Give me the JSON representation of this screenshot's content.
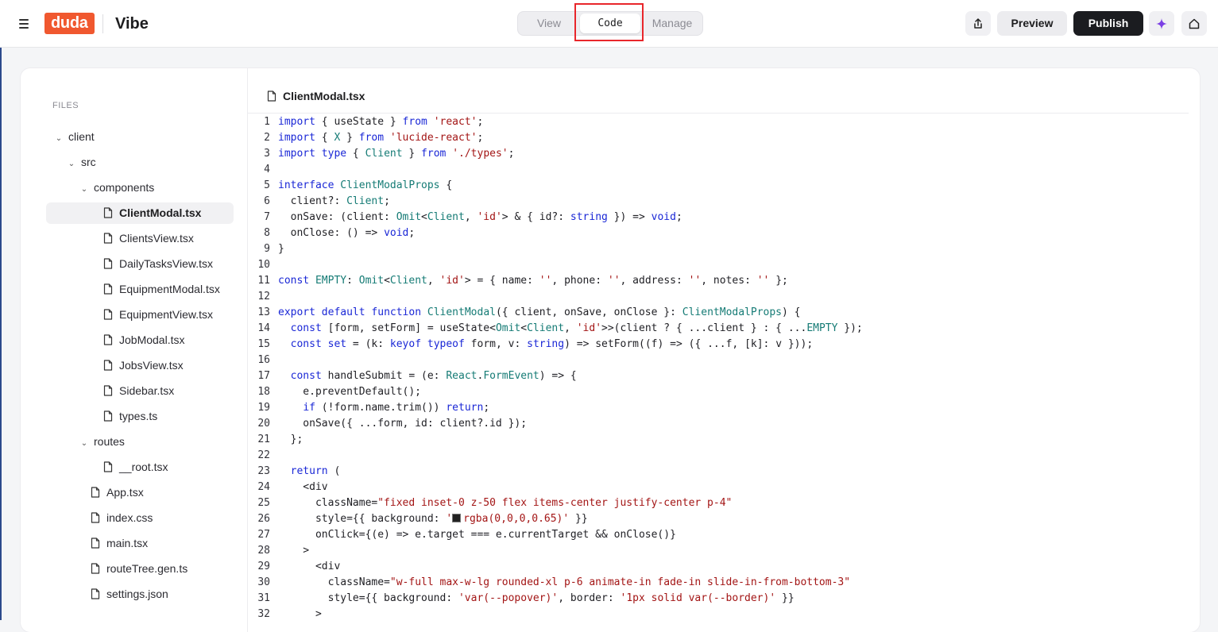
{
  "topbar": {
    "logo": "duda",
    "brand": "Vibe",
    "tabs": [
      {
        "label": "View"
      },
      {
        "label": "Code"
      },
      {
        "label": "Manage"
      }
    ],
    "preview_label": "Preview",
    "publish_label": "Publish"
  },
  "files": {
    "label": "FILES",
    "items": [
      {
        "label": "client",
        "kind": "folder"
      },
      {
        "label": "src",
        "kind": "folder"
      },
      {
        "label": "components",
        "kind": "folder"
      },
      {
        "label": "ClientModal.tsx",
        "kind": "file",
        "selected": true
      },
      {
        "label": "ClientsView.tsx",
        "kind": "file"
      },
      {
        "label": "DailyTasksView.tsx",
        "kind": "file"
      },
      {
        "label": "EquipmentModal.tsx",
        "kind": "file"
      },
      {
        "label": "EquipmentView.tsx",
        "kind": "file"
      },
      {
        "label": "JobModal.tsx",
        "kind": "file"
      },
      {
        "label": "JobsView.tsx",
        "kind": "file"
      },
      {
        "label": "Sidebar.tsx",
        "kind": "file"
      },
      {
        "label": "types.ts",
        "kind": "file"
      },
      {
        "label": "routes",
        "kind": "folder"
      },
      {
        "label": "__root.tsx",
        "kind": "file"
      },
      {
        "label": "App.tsx",
        "kind": "file"
      },
      {
        "label": "index.css",
        "kind": "file"
      },
      {
        "label": "main.tsx",
        "kind": "file"
      },
      {
        "label": "routeTree.gen.ts",
        "kind": "file"
      },
      {
        "label": "settings.json",
        "kind": "file"
      }
    ]
  },
  "editor": {
    "filename": "ClientModal.tsx",
    "lines": [
      {
        "n": "1",
        "t": [
          [
            "kw",
            "import"
          ],
          [
            "p",
            " { useState } "
          ],
          [
            "kw",
            "from"
          ],
          [
            "p",
            " "
          ],
          [
            "str",
            "'react'"
          ],
          [
            "p",
            ";"
          ]
        ]
      },
      {
        "n": "2",
        "t": [
          [
            "kw",
            "import"
          ],
          [
            "p",
            " { "
          ],
          [
            "ty",
            "X"
          ],
          [
            "p",
            " } "
          ],
          [
            "kw",
            "from"
          ],
          [
            "p",
            " "
          ],
          [
            "str",
            "'lucide-react'"
          ],
          [
            "p",
            ";"
          ]
        ]
      },
      {
        "n": "3",
        "t": [
          [
            "kw",
            "import"
          ],
          [
            "p",
            " "
          ],
          [
            "kw",
            "type"
          ],
          [
            "p",
            " { "
          ],
          [
            "ty",
            "Client"
          ],
          [
            "p",
            " } "
          ],
          [
            "kw",
            "from"
          ],
          [
            "p",
            " "
          ],
          [
            "str",
            "'./types'"
          ],
          [
            "p",
            ";"
          ]
        ]
      },
      {
        "n": "4",
        "t": []
      },
      {
        "n": "5",
        "t": [
          [
            "kw",
            "interface"
          ],
          [
            "p",
            " "
          ],
          [
            "ty",
            "ClientModalProps"
          ],
          [
            "p",
            " {"
          ]
        ]
      },
      {
        "n": "6",
        "t": [
          [
            "p",
            "  client?: "
          ],
          [
            "ty",
            "Client"
          ],
          [
            "p",
            ";"
          ]
        ]
      },
      {
        "n": "7",
        "t": [
          [
            "p",
            "  onSave: (client: "
          ],
          [
            "ty",
            "Omit"
          ],
          [
            "p",
            "<"
          ],
          [
            "ty",
            "Client"
          ],
          [
            "p",
            ", "
          ],
          [
            "str",
            "'id'"
          ],
          [
            "p",
            "> & { id?: "
          ],
          [
            "kw",
            "string"
          ],
          [
            "p",
            " }) => "
          ],
          [
            "kw",
            "void"
          ],
          [
            "p",
            ";"
          ]
        ]
      },
      {
        "n": "8",
        "t": [
          [
            "p",
            "  onClose: () => "
          ],
          [
            "kw",
            "void"
          ],
          [
            "p",
            ";"
          ]
        ]
      },
      {
        "n": "9",
        "t": [
          [
            "p",
            "}"
          ]
        ]
      },
      {
        "n": "10",
        "t": []
      },
      {
        "n": "11",
        "t": [
          [
            "kw",
            "const"
          ],
          [
            "p",
            " "
          ],
          [
            "ty",
            "EMPTY"
          ],
          [
            "p",
            ": "
          ],
          [
            "ty",
            "Omit"
          ],
          [
            "p",
            "<"
          ],
          [
            "ty",
            "Client"
          ],
          [
            "p",
            ", "
          ],
          [
            "str",
            "'id'"
          ],
          [
            "p",
            "> = { name: "
          ],
          [
            "str",
            "''"
          ],
          [
            "p",
            ", phone: "
          ],
          [
            "str",
            "''"
          ],
          [
            "p",
            ", address: "
          ],
          [
            "str",
            "''"
          ],
          [
            "p",
            ", notes: "
          ],
          [
            "str",
            "''"
          ],
          [
            "p",
            " };"
          ]
        ]
      },
      {
        "n": "12",
        "t": []
      },
      {
        "n": "13",
        "t": [
          [
            "kw",
            "export"
          ],
          [
            "p",
            " "
          ],
          [
            "kw",
            "default"
          ],
          [
            "p",
            " "
          ],
          [
            "kw",
            "function"
          ],
          [
            "p",
            " "
          ],
          [
            "ty",
            "ClientModal"
          ],
          [
            "p",
            "({ client, onSave, onClose }: "
          ],
          [
            "ty",
            "ClientModalProps"
          ],
          [
            "p",
            ") {"
          ]
        ]
      },
      {
        "n": "14",
        "t": [
          [
            "p",
            "  "
          ],
          [
            "kw",
            "const"
          ],
          [
            "p",
            " [form, setForm] = useState<"
          ],
          [
            "ty",
            "Omit"
          ],
          [
            "p",
            "<"
          ],
          [
            "ty",
            "Client"
          ],
          [
            "p",
            ", "
          ],
          [
            "str",
            "'id'"
          ],
          [
            "p",
            ">>(client ? { ...client } : { ..."
          ],
          [
            "ty",
            "EMPTY"
          ],
          [
            "p",
            " });"
          ]
        ]
      },
      {
        "n": "15",
        "t": [
          [
            "p",
            "  "
          ],
          [
            "kw",
            "const"
          ],
          [
            "p",
            " "
          ],
          [
            "kw",
            "set"
          ],
          [
            "p",
            " = (k: "
          ],
          [
            "kw",
            "keyof"
          ],
          [
            "p",
            " "
          ],
          [
            "kw",
            "typeof"
          ],
          [
            "p",
            " form, v: "
          ],
          [
            "kw",
            "string"
          ],
          [
            "p",
            ") => setForm((f) => ({ ...f, [k]: v }));"
          ]
        ]
      },
      {
        "n": "16",
        "t": []
      },
      {
        "n": "17",
        "t": [
          [
            "p",
            "  "
          ],
          [
            "kw",
            "const"
          ],
          [
            "p",
            " handleSubmit = (e: "
          ],
          [
            "ty",
            "React"
          ],
          [
            "p",
            "."
          ],
          [
            "ty",
            "FormEvent"
          ],
          [
            "p",
            ") => {"
          ]
        ]
      },
      {
        "n": "18",
        "t": [
          [
            "p",
            "    e.preventDefault();"
          ]
        ]
      },
      {
        "n": "19",
        "t": [
          [
            "p",
            "    "
          ],
          [
            "kw",
            "if"
          ],
          [
            "p",
            " (!form.name.trim()) "
          ],
          [
            "kw",
            "return"
          ],
          [
            "p",
            ";"
          ]
        ]
      },
      {
        "n": "20",
        "t": [
          [
            "p",
            "    onSave({ ...form, id: client?.id });"
          ]
        ]
      },
      {
        "n": "21",
        "t": [
          [
            "p",
            "  };"
          ]
        ]
      },
      {
        "n": "22",
        "t": []
      },
      {
        "n": "23",
        "t": [
          [
            "p",
            "  "
          ],
          [
            "kw",
            "return"
          ],
          [
            "p",
            " ("
          ]
        ]
      },
      {
        "n": "24",
        "t": [
          [
            "p",
            "    <div"
          ]
        ]
      },
      {
        "n": "25",
        "t": [
          [
            "p",
            "      className="
          ],
          [
            "str",
            "\"fixed inset-0 z-50 flex items-center justify-center p-4\""
          ]
        ]
      },
      {
        "n": "26",
        "t": [
          [
            "p",
            "      style={{ background: "
          ],
          [
            "str",
            "'"
          ],
          [
            "sw",
            ""
          ],
          [
            "str",
            "rgba(0,0,0,0.65)'"
          ],
          [
            "p",
            " }}"
          ]
        ]
      },
      {
        "n": "27",
        "t": [
          [
            "p",
            "      onClick={(e) => e.target === e.currentTarget && onClose()}"
          ]
        ]
      },
      {
        "n": "28",
        "t": [
          [
            "p",
            "    >"
          ]
        ]
      },
      {
        "n": "29",
        "t": [
          [
            "p",
            "      <div"
          ]
        ]
      },
      {
        "n": "30",
        "t": [
          [
            "p",
            "        className="
          ],
          [
            "str",
            "\"w-full max-w-lg rounded-xl p-6 animate-in fade-in slide-in-from-bottom-3\""
          ]
        ]
      },
      {
        "n": "31",
        "t": [
          [
            "p",
            "        style={{ background: "
          ],
          [
            "str",
            "'var(--popover)'"
          ],
          [
            "p",
            ", border: "
          ],
          [
            "str",
            "'1px solid var(--border)'"
          ],
          [
            "p",
            " }}"
          ]
        ]
      },
      {
        "n": "32",
        "t": [
          [
            "p",
            "      >"
          ]
        ]
      }
    ]
  }
}
